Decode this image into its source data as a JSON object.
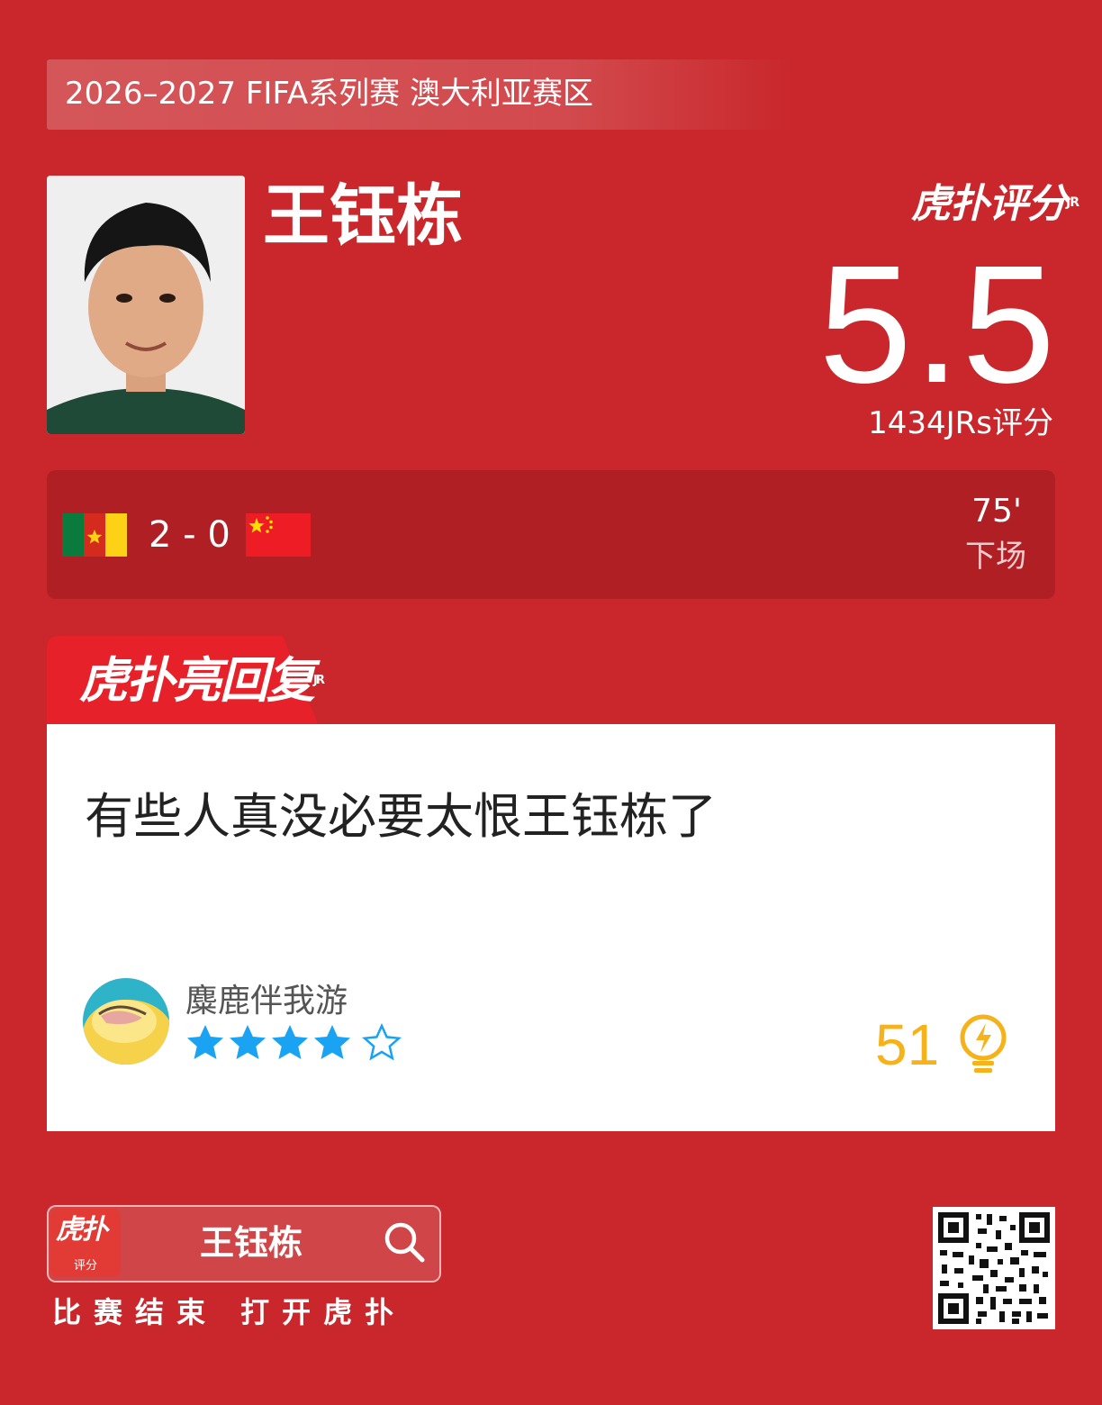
{
  "banner": {
    "text": "2026–2027 FIFA系列赛 澳大利亚赛区"
  },
  "player": {
    "name": "王钰栋"
  },
  "brand": {
    "logo_text": "虎扑评分",
    "jr_tag": "JR"
  },
  "rating": {
    "score": "5.5",
    "count_label": "1434JRs评分"
  },
  "match": {
    "score": "2 - 0",
    "minute": "75'",
    "status": "下场"
  },
  "highlight": {
    "label": "虎扑亮回复",
    "jr_tag": "JR"
  },
  "reply": {
    "text": "有些人真没必要太恨王钰栋了",
    "username": "麋鹿伴我游",
    "stars_filled": 4,
    "stars_total": 5,
    "likes": "51"
  },
  "footer": {
    "app_icon_text": "虎扑",
    "app_icon_sub": "评分",
    "search_text": "王钰栋",
    "tagline": "比赛结束 打开虎扑"
  },
  "colors": {
    "background": "#c9272b",
    "match_bar": "#b01f24",
    "star": "#19a3f2",
    "likes": "#f5b21b"
  },
  "icons": [
    "search-icon",
    "bulb-icon",
    "star-icon",
    "cameroon-flag",
    "china-flag",
    "qr-code"
  ]
}
